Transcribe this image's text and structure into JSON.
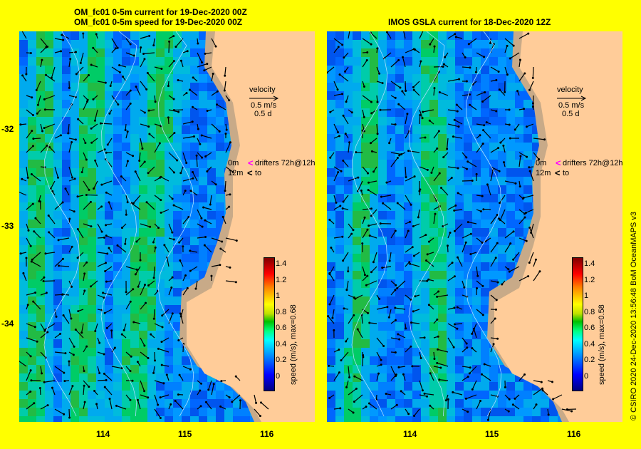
{
  "left_panel": {
    "title_line1": "OM_fc01 0-5m current for 19-Dec-2020 00Z",
    "title_line2": "OM_fc01 0-5m speed for 19-Dec-2020 00Z",
    "colorbar_label": "speed (m/s), max=0.68"
  },
  "right_panel": {
    "title": "IMOS GSLA current for 18-Dec-2020 12Z",
    "colorbar_label": "speed (m/s), max=0.58"
  },
  "legend": {
    "velocity_label": "velocity",
    "velocity_scale": "0.5 m/s",
    "velocity_days": "0.5 d",
    "drifters_label": "drifters 72h@12h",
    "drifter_depth_0": "0m",
    "drifter_depth_12": "12m",
    "drifter_to": "to",
    "drifter_color": "#ff00ff"
  },
  "axes": {
    "y_ticks": [
      "-32",
      "-33",
      "-34"
    ],
    "x_ticks": [
      "114",
      "115",
      "116"
    ]
  },
  "colorbar": {
    "ticks": [
      "1.4",
      "1.2",
      "1",
      "0.8",
      "0.6",
      "0.4",
      "0.2",
      "0"
    ]
  },
  "credit": "© CSIRO 2020   24-Dec-2020 13:56:48 BoM OceanMAPS v3",
  "colors": {
    "land": "#ffcc99",
    "shelf": "#c8aa88",
    "background": "#ffff00"
  }
}
